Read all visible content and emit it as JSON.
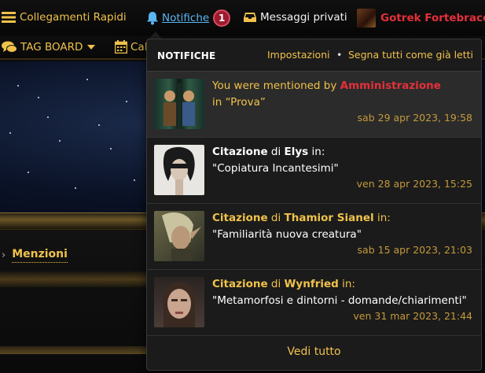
{
  "topbar": {
    "quick_links": "Collegamenti Rapidi",
    "notifications_label": "Notifiche",
    "notifications_count": "1",
    "private_messages": "Messaggi privati",
    "username": "Gotrek Fortebraccio"
  },
  "nav2": {
    "tag_board": "TAG BOARD",
    "calendar": "Calendario"
  },
  "breadcrumb": {
    "current": "Menzioni"
  },
  "dropdown": {
    "title": "NOTIFICHE",
    "settings": "Impostazioni",
    "separator": "•",
    "mark_all": "Segna tutti come già letti",
    "view_all": "Vedi tutto",
    "items": [
      {
        "prefix": "You were mentioned by ",
        "actor": "Amministrazione",
        "line2": "in “Prova”",
        "time": "sab 29 apr 2023, 19:58",
        "unread": true
      },
      {
        "kind": "Citazione",
        "connector": " di ",
        "actor": "Elys",
        "suffix": " in:",
        "line2": "\"Copiatura Incantesimi\"",
        "time": "ven 28 apr 2023, 15:25",
        "unread": false
      },
      {
        "kind": "Citazione",
        "connector": " di ",
        "actor": "Thamior Sianel",
        "suffix": " in:",
        "line2": "\"Familiarità nuova creatura\"",
        "time": "sab 15 apr 2023, 21:03",
        "unread": false
      },
      {
        "kind": "Citazione",
        "connector": " di ",
        "actor": "Wynfried",
        "suffix": " in:",
        "line2": "\"Metamorfosi e dintorni - domande/chiarimenti\"",
        "time": "ven 31 mar 2023, 21:44",
        "unread": false
      }
    ]
  },
  "colors": {
    "accent_gold": "#f0c24a",
    "username_red": "#e3303a",
    "link_blue": "#5ab6f0",
    "badge_bg": "#9c1b2e"
  }
}
